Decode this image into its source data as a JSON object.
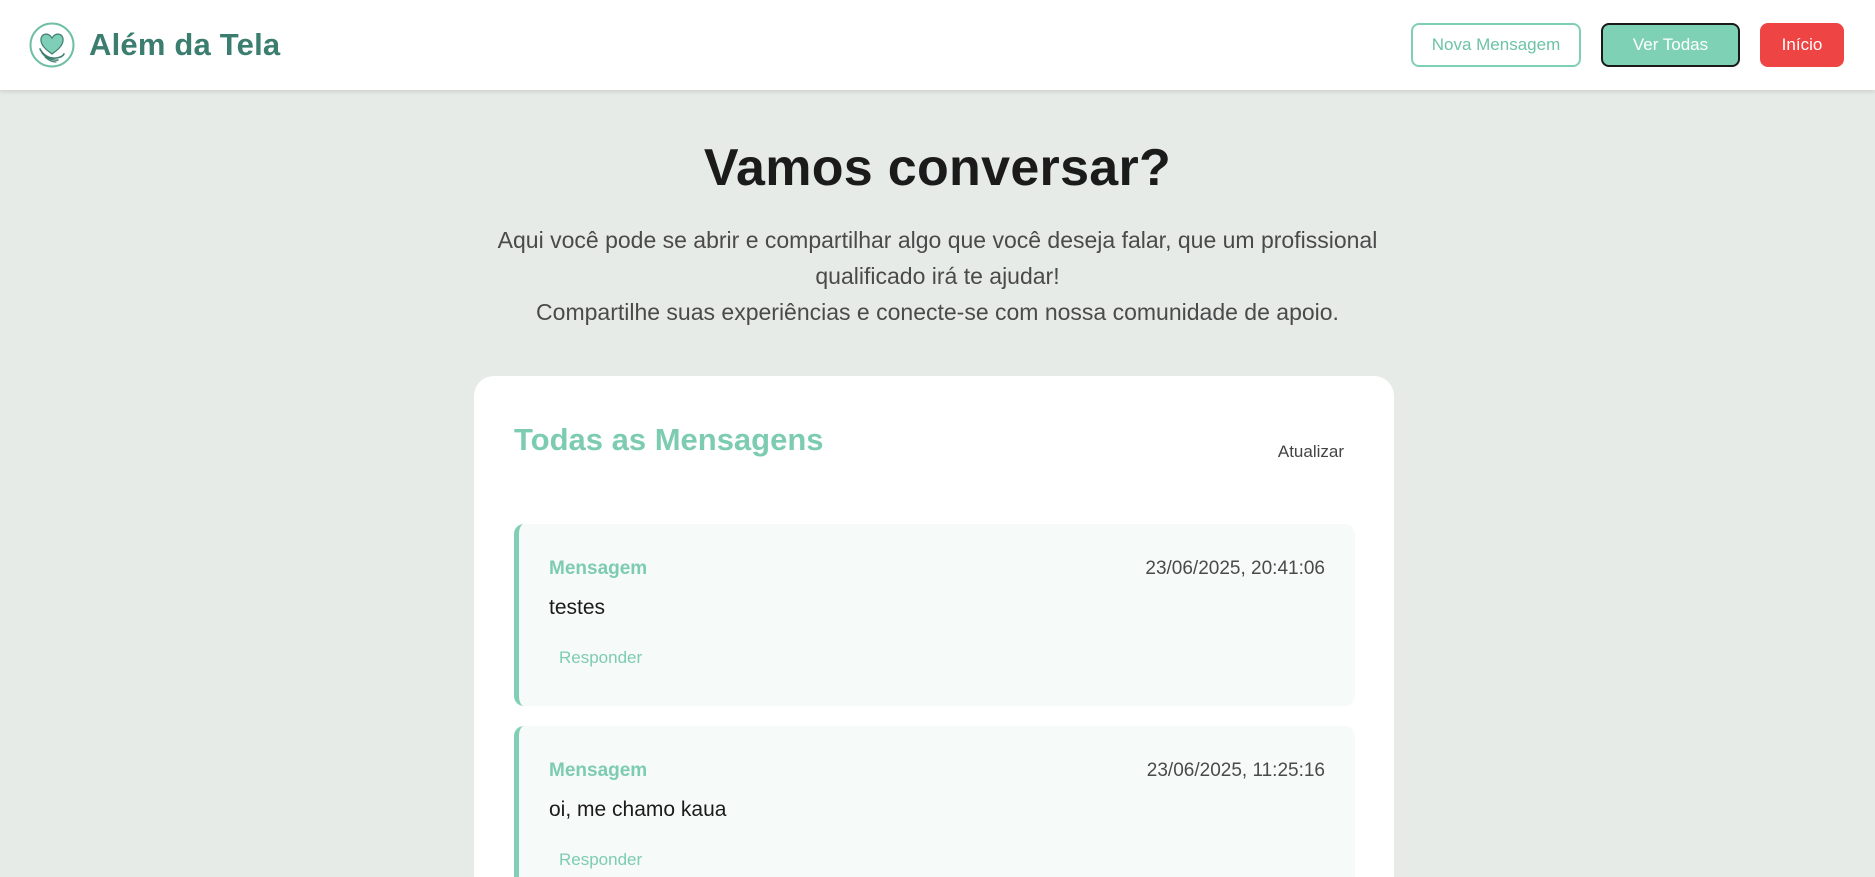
{
  "app": {
    "brand_name": "Além da Tela",
    "logo_icon": "heart-hands-logo"
  },
  "nav": {
    "new_message_label": "Nova Mensagem",
    "view_all_label": "Ver Todas",
    "home_label": "Início"
  },
  "hero": {
    "title": "Vamos conversar?",
    "line1": "Aqui você pode se abrir e compartilhar algo que você deseja falar, que um profissional qualificado irá te ajudar!",
    "line2": "Compartilhe suas experiências e conecte-se com nossa comunidade de apoio."
  },
  "messages_panel": {
    "title": "Todas as Mensagens",
    "refresh_label": "Atualizar",
    "items": [
      {
        "label": "Mensagem",
        "timestamp": "23/06/2025, 20:41:06",
        "text": "testes",
        "reply_label": "Responder"
      },
      {
        "label": "Mensagem",
        "timestamp": "23/06/2025, 11:25:16",
        "text": "oi, me chamo kaua",
        "reply_label": "Responder"
      }
    ]
  },
  "colors": {
    "accent": "#7fcfb6",
    "brand_text": "#3b7d6f",
    "danger": "#ef4444",
    "page_bg": "#e6ebe8"
  }
}
